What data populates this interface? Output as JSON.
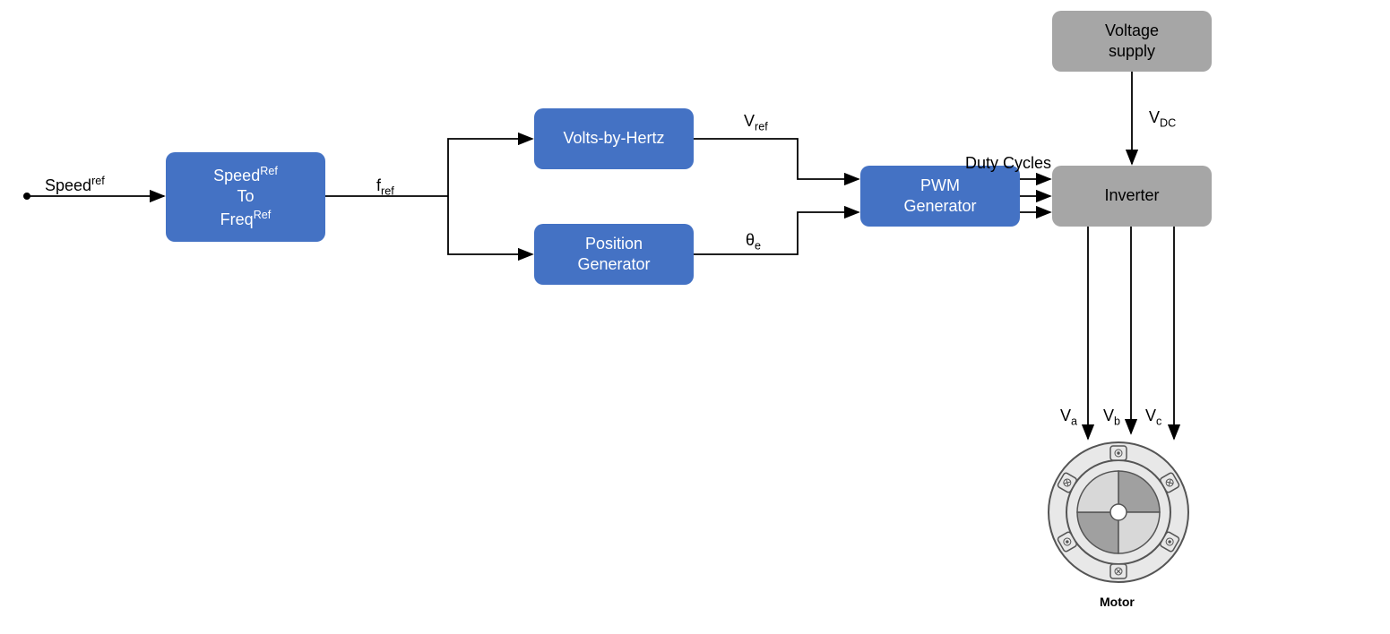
{
  "labels": {
    "speedRef": "Speed",
    "speedRefSup": "ref",
    "fRef": "f",
    "fRefSub": "ref",
    "vRef": "V",
    "vRefSub": "ref",
    "thetaE": "θ",
    "thetaESub": "e",
    "dutyCycles": "Duty Cycles",
    "vDC": "V",
    "vDCSub": "DC",
    "va": "V",
    "vaSub": "a",
    "vb": "V",
    "vbSub": "b",
    "vc": "V",
    "vcSub": "c",
    "motor": "Motor"
  },
  "blocks": {
    "speedToFreq": {
      "line1": "Speed",
      "line1Sup": "Ref",
      "line2": "To",
      "line3": "Freq",
      "line3Sup": "Ref"
    },
    "voltsByHertz": "Volts-by-Hertz",
    "positionGenerator": {
      "line1": "Position",
      "line2": "Generator"
    },
    "pwmGenerator": {
      "line1": "PWM",
      "line2": "Generator"
    },
    "voltageSupply": {
      "line1": "Voltage",
      "line2": "supply"
    },
    "inverter": "Inverter"
  }
}
